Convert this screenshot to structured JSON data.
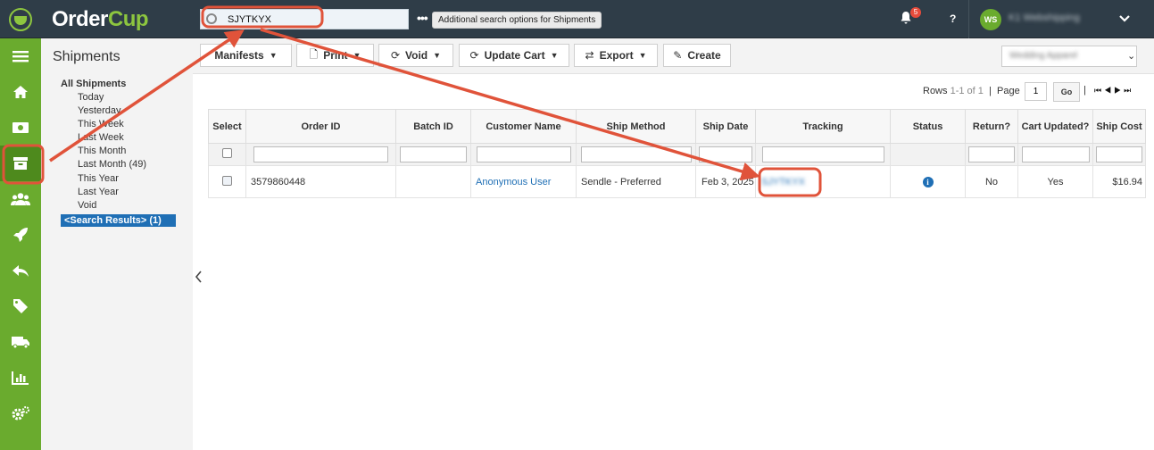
{
  "app": {
    "logo_order": "Order",
    "logo_cup": "Cup"
  },
  "topbar": {
    "search_value": "SJYTKYX",
    "search_more": "•••",
    "search_tooltip": "Additional search options for Shipments",
    "notifications_count": "5",
    "help_label": "?",
    "user_initials": "WS",
    "user_name": "K1 Webshipping"
  },
  "leftnav": {
    "items": [
      {
        "icon": "menu-icon"
      },
      {
        "icon": "home-icon"
      },
      {
        "icon": "money-icon"
      },
      {
        "icon": "box-icon"
      },
      {
        "icon": "users-icon"
      },
      {
        "icon": "rocket-icon"
      },
      {
        "icon": "return-icon"
      },
      {
        "icon": "tag-icon"
      },
      {
        "icon": "truck-icon"
      },
      {
        "icon": "chart-icon"
      },
      {
        "icon": "gears-icon"
      }
    ],
    "active_index": 3
  },
  "subpanel": {
    "title": "Shipments",
    "root": "All Shipments",
    "items": [
      "Today",
      "Yesterday",
      "This Week",
      "Last Week",
      "This Month",
      "Last Month (49)",
      "This Year",
      "Last Year",
      "Void"
    ],
    "selected": "<Search Results> (1)"
  },
  "toolbar": {
    "manifests": "Manifests",
    "print": "Print",
    "void": "Void",
    "update_cart": "Update Cart",
    "export": "Export",
    "create": "Create",
    "ship_filter": "Wedding Apparel"
  },
  "pager": {
    "rows_label": "Rows",
    "rows_range": "1-1 of 1",
    "sep": "|",
    "page_label": "Page",
    "page_value": "1",
    "go": "Go"
  },
  "table": {
    "headers": [
      "Select",
      "Order ID",
      "Batch ID",
      "Customer Name",
      "Ship Method",
      "Ship Date",
      "Tracking",
      "Status",
      "Return?",
      "Cart Updated?",
      "Ship Cost"
    ],
    "rows": [
      {
        "order_id": "3579860448",
        "batch_id": "",
        "customer": "Anonymous User",
        "ship_method": "Sendle - Preferred",
        "ship_date": "Feb 3, 2025",
        "tracking": "SJYTKYX",
        "return": "No",
        "cart_updated": "Yes",
        "ship_cost": "$16.94"
      }
    ]
  },
  "colors": {
    "topbar": "#2f3d48",
    "nav_green": "#6aab2e",
    "link_blue": "#1f6fb5",
    "annotation_red": "#e0533a"
  }
}
